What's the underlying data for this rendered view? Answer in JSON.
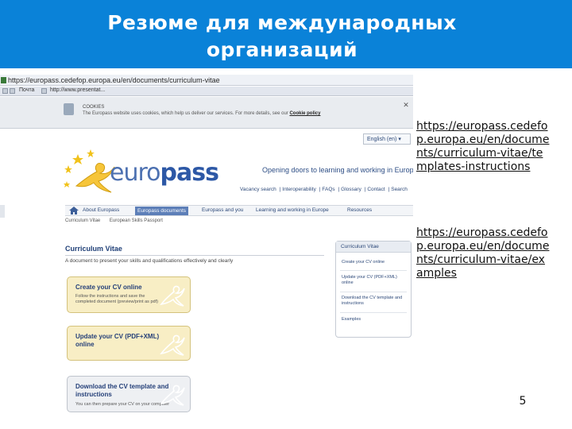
{
  "slide": {
    "title_line1": "Резюме для международных",
    "title_line2": "организаций",
    "header_color": "#0a82d8",
    "page_number": "5"
  },
  "links": [
    "https://europass.cedefop.europa.eu/en/documents/curriculum-vitae/templates-instructions",
    "https://europass.cedefop.europa.eu/en/documents/curriculum-vitae/examples"
  ],
  "browser": {
    "url": "https://europass.cedefop.europa.eu/en/documents/curriculum-vitae",
    "bookmarks": [
      "Почта",
      "http://www.presentat..."
    ],
    "cookie_title": "COOKIES",
    "cookie_text": "The Europass website uses cookies, which help us deliver our services. For more details, see our",
    "cookie_link": "Cookie policy",
    "language": "English (en)",
    "logo_word_e": "euro",
    "logo_word_p": "pass",
    "tagline": "Opening doors to learning and working in Europe",
    "top_links": [
      "Vacancy search",
      "Interoperability",
      "FAQs",
      "Glossary",
      "Contact",
      "Search"
    ],
    "nav_items": [
      "About Europass",
      "Europass documents",
      "Europass and you",
      "Learning and working in Europe",
      "Resources"
    ],
    "active_nav": "Europass documents",
    "subnav": [
      "Curriculum Vitae",
      "European Skills Passport"
    ],
    "main_title": "Curriculum Vitae",
    "main_sub": "A document to present your skills and qualifications effectively and clearly",
    "cv_boxes": [
      {
        "title": "Create your CV online",
        "desc": "Follow the instructions and save the completed document (preview/print as pdf)"
      },
      {
        "title": "Update your CV (PDF+XML) online",
        "desc": ""
      },
      {
        "title": "Download the CV template and instructions",
        "desc": "You can then prepare your CV on your computer"
      }
    ],
    "side_panel": {
      "heading": "Curriculum Vitae",
      "links": [
        "Create your CV online",
        "Update your CV (PDF+XML) online",
        "Download the CV template and instructions",
        "Examples"
      ]
    }
  }
}
